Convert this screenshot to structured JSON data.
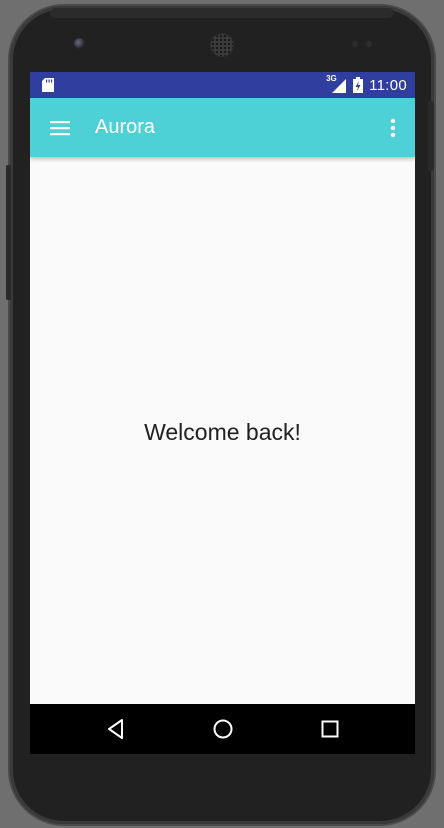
{
  "device": {
    "camera_icon": "front-camera-icon",
    "speaker_icon": "speaker-grille-icon"
  },
  "status_bar": {
    "left_icon": "sd-card-icon",
    "network_label": "3G",
    "network_icon": "cell-signal-icon",
    "battery_icon": "battery-charging-icon",
    "time": "11:00",
    "background_color": "#303f9f"
  },
  "toolbar": {
    "menu_icon": "hamburger-menu-icon",
    "title": "Aurora",
    "overflow_icon": "more-vert-icon",
    "background_color": "#4dd0d6"
  },
  "content": {
    "message": "Welcome back!"
  },
  "nav_bar": {
    "back_icon": "back-triangle-icon",
    "home_icon": "home-circle-icon",
    "recents_icon": "recents-square-icon"
  }
}
